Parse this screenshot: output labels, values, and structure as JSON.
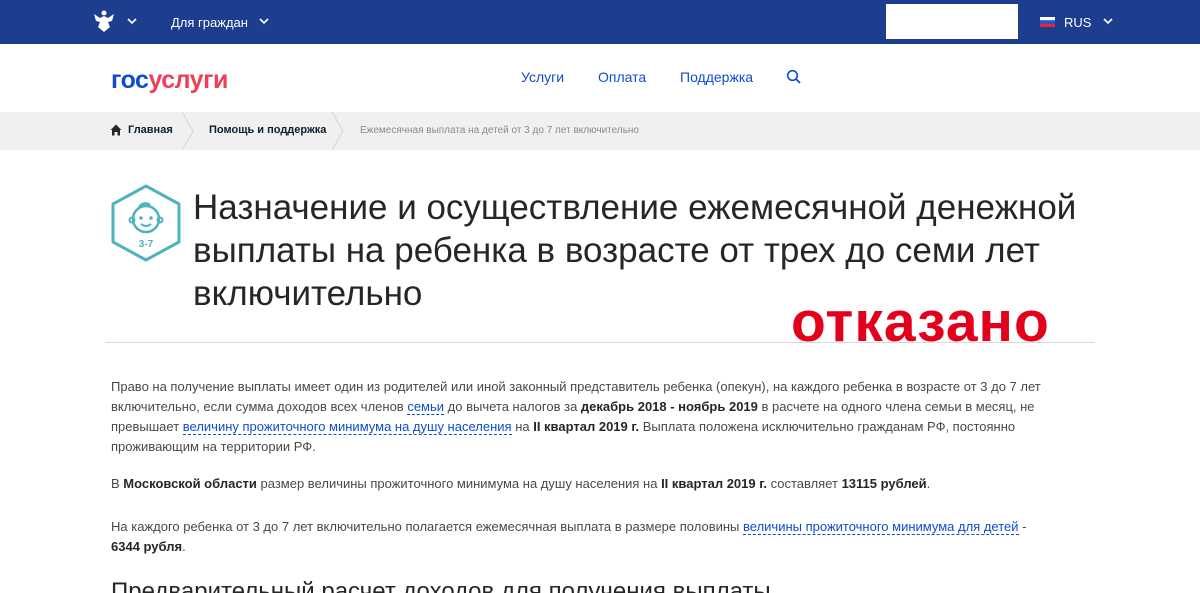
{
  "topbar": {
    "emblem_icon": "russian-eagle-emblem-icon",
    "for_citizens": "Для граждан",
    "language": "RUS"
  },
  "header": {
    "logo_part1": "гос",
    "logo_part2": "услуги",
    "nav": [
      "Услуги",
      "Оплата",
      "Поддержка"
    ],
    "search_icon": "search-icon"
  },
  "breadcrumb": {
    "home": "Главная",
    "support": "Помощь и поддержка",
    "current": "Ежемесячная выплата на детей от 3 до 7 лет включительно"
  },
  "page": {
    "icon_label": "3-7",
    "title": "Назначение и осуществление ежемесячной денежной выплаты на ребенка в возрасте от трех до семи лет включительно",
    "stamp": "отказано",
    "p1": {
      "t1": "Право на получение выплаты имеет один из родителей или иной законный представитель ребенка (опекун), на каждого ребенка в возрасте от 3 до 7 лет включительно, если сумма доходов всех членов ",
      "link1": "семьи",
      "t2": " до вычета налогов за ",
      "b1": "декабрь 2018 - ноябрь 2019",
      "t3": " в расчете на одного члена семьи в месяц, не превышает ",
      "link2": "величину прожиточного минимума на душу населения",
      "t4": " на ",
      "b2": "II квартал 2019 г.",
      "t5": " Выплата положена исключительно гражданам РФ, постоянно проживающим на территории РФ."
    },
    "p2": {
      "t1": "В ",
      "b1": "Московской области",
      "t2": " размер величины прожиточного минимума на душу населения на ",
      "b2": "II квартал 2019 г.",
      "t3": " составляет ",
      "b3": "13115 рублей",
      "t4": "."
    },
    "p3": {
      "t1": "На каждого ребенка от 3 до 7 лет включительно полагается ежемесячная выплата в размере половины ",
      "link1": "величины прожиточного минимума для детей",
      "t2": " - ",
      "b1": "6344 рубля",
      "t3": "."
    },
    "section_title": "Предварительный расчет доходов для получения выплаты"
  },
  "colors": {
    "topbar": "#1d3e8f",
    "link": "#0d4cd3",
    "logo_red": "#ee3f58",
    "stamp": "#e3001b",
    "icon_teal": "#4fb3bf"
  }
}
